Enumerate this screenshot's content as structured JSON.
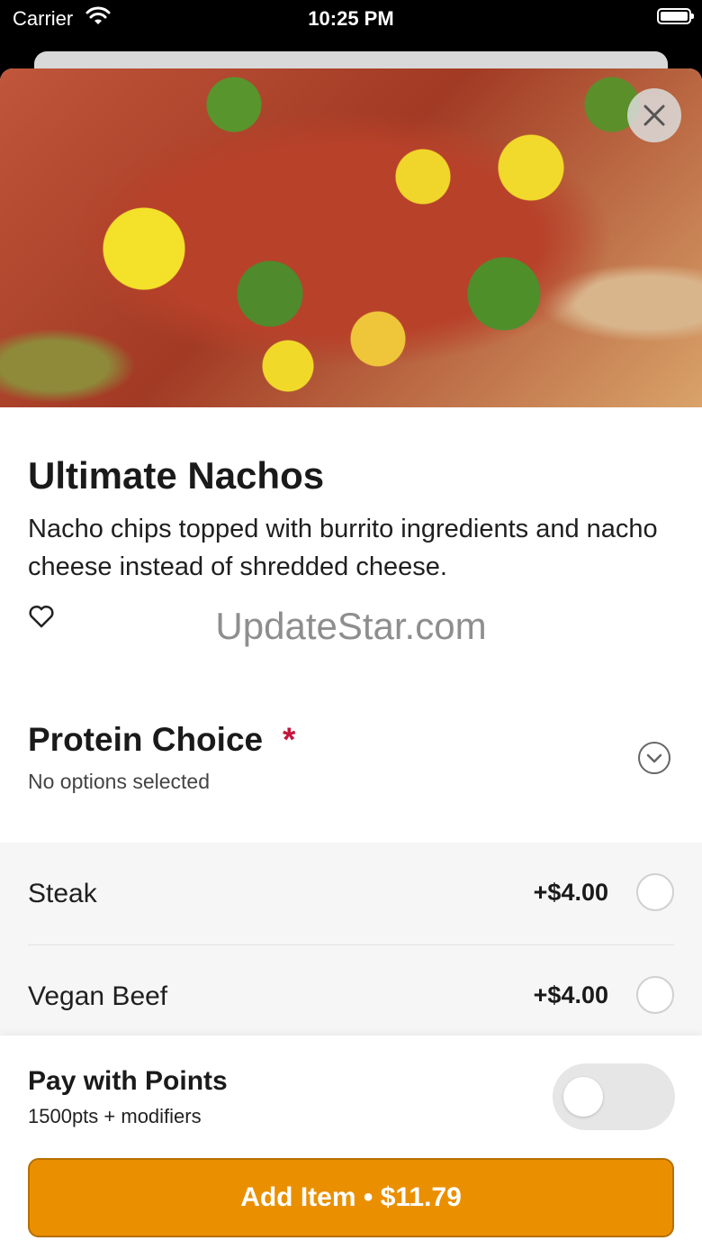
{
  "status_bar": {
    "carrier": "Carrier",
    "time": "10:25 PM"
  },
  "item": {
    "title": "Ultimate Nachos",
    "description": "Nacho chips topped with burrito ingredients and nacho cheese instead of shredded cheese."
  },
  "watermark": "UpdateStar.com",
  "modifier_group": {
    "title": "Protein Choice",
    "required_mark": "*",
    "subtitle": "No options selected",
    "options": [
      {
        "name": "Steak",
        "price": "+$4.00"
      },
      {
        "name": "Vegan Beef",
        "price": "+$4.00"
      }
    ]
  },
  "footer": {
    "points_title": "Pay with Points",
    "points_subtitle": "1500pts + modifiers",
    "points_enabled": false,
    "add_button": "Add Item • $11.79"
  },
  "colors": {
    "accent": "#EA9000",
    "required": "#C4163C"
  },
  "icons": [
    "close-icon",
    "heart-icon",
    "chevron-down-icon",
    "wifi-icon",
    "battery-icon"
  ]
}
